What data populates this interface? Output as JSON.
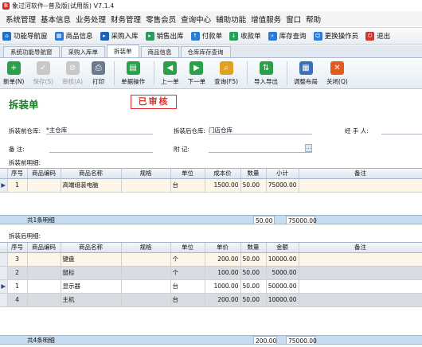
{
  "window": {
    "title": "象过河软件--普及版(试用版) V7.1.4"
  },
  "menu": [
    "系统管理",
    "基本信息",
    "业务处理",
    "财务管理",
    "零售会员",
    "查询中心",
    "辅助功能",
    "增值服务",
    "窗口",
    "帮助"
  ],
  "quickbar": [
    {
      "label": "功能导航窗",
      "icon": "home-icon",
      "color": "#1d6fd0"
    },
    {
      "label": "商品信息",
      "icon": "product-grid-icon",
      "color": "#2a7ad6"
    },
    {
      "label": "采购入库",
      "icon": "purchase-in-icon",
      "color": "#1e5fb8"
    },
    {
      "label": "销售出库",
      "icon": "sales-out-icon",
      "color": "#2a9d5a"
    },
    {
      "label": "付款单",
      "icon": "payment-icon",
      "color": "#2a7ad6"
    },
    {
      "label": "收款单",
      "icon": "receipt-icon",
      "color": "#2a9d5a"
    },
    {
      "label": "库存查询",
      "icon": "stock-query-icon",
      "color": "#2a7ad6"
    },
    {
      "label": "更换操作员",
      "icon": "switch-user-icon",
      "color": "#2a7ad6"
    },
    {
      "label": "退出",
      "icon": "exit-icon",
      "color": "#d8322b"
    }
  ],
  "tabs": [
    "系统功能导航窗",
    "采购入库单",
    "拆装单",
    "商品信息",
    "仓库库存查询"
  ],
  "active_tab": 2,
  "toolbar": [
    {
      "label": "新单(N)",
      "icon": "new-icon",
      "color": "#2aa04a",
      "glyph": "+",
      "enabled": true
    },
    {
      "label": "保存(S)",
      "icon": "save-icon",
      "color": "#888888",
      "glyph": "✓",
      "enabled": false
    },
    {
      "label": "审核(A)",
      "icon": "approve-icon",
      "color": "#888888",
      "glyph": "⊘",
      "enabled": false
    },
    {
      "label": "打印",
      "icon": "print-icon",
      "color": "#6b7a90",
      "glyph": "⎙",
      "enabled": true
    },
    {
      "label": "单据操作",
      "icon": "document-ops-icon",
      "color": "#2aa04a",
      "glyph": "▤",
      "enabled": true
    },
    {
      "label": "上一单",
      "icon": "previous-icon",
      "color": "#2aa04a",
      "glyph": "◀",
      "enabled": true
    },
    {
      "label": "下一单",
      "icon": "next-icon",
      "color": "#2aa04a",
      "glyph": "▶",
      "enabled": true
    },
    {
      "label": "查询(F5)",
      "icon": "query-icon",
      "color": "#e0a020",
      "glyph": "⌕",
      "enabled": true
    },
    {
      "label": "导入导出",
      "icon": "import-export-icon",
      "color": "#2aa04a",
      "glyph": "⇅",
      "enabled": true
    },
    {
      "label": "调整布局",
      "icon": "layout-icon",
      "color": "#3b6fb6",
      "glyph": "▦",
      "enabled": true
    },
    {
      "label": "关闭(Q)",
      "icon": "close-icon",
      "color": "#e35a1f",
      "glyph": "✕",
      "enabled": true
    }
  ],
  "form": {
    "title": "拆装单",
    "stamp": "已审核",
    "before_warehouse_label": "拆装前仓库:",
    "before_warehouse_value": "*主仓库",
    "after_warehouse_label": "拆装后仓库:",
    "after_warehouse_value": "门店仓库",
    "handler_label": "经 手 人:",
    "handler_value": "",
    "remark_label": "备    注:",
    "remark_value": "",
    "attachment_label": "附    记:",
    "attachment_value": "",
    "attachment_button": "…"
  },
  "before_grid": {
    "label": "拆装前明细:",
    "headers": [
      "序号",
      "商品编码",
      "商品名称",
      "规格",
      "单位",
      "成本价",
      "数量",
      "小计",
      "备注"
    ],
    "rows": [
      [
        "1",
        "",
        "高端组装电脑",
        "",
        "台",
        "1500.00",
        "50.00",
        "75000.00",
        ""
      ]
    ],
    "summary": {
      "count": "共1条明细",
      "qty": "50.00",
      "total": "75000.00"
    }
  },
  "after_grid": {
    "label": "拆装后明细:",
    "headers": [
      "序号",
      "商品编码",
      "商品名称",
      "规格",
      "单位",
      "单价",
      "数量",
      "金额",
      "备注"
    ],
    "rows": [
      [
        "3",
        "",
        "键盘",
        "",
        "个",
        "200.00",
        "50.00",
        "10000.00",
        ""
      ],
      [
        "2",
        "",
        "鼠标",
        "",
        "个",
        "100.00",
        "50.00",
        "5000.00",
        ""
      ],
      [
        "1",
        "",
        "显示器",
        "",
        "台",
        "1000.00",
        "50.00",
        "50000.00",
        ""
      ],
      [
        "4",
        "",
        "主机",
        "",
        "台",
        "200.00",
        "50.00",
        "10000.00",
        ""
      ]
    ],
    "summary": {
      "count": "共4条明细",
      "qty": "200.00",
      "total": "75000.00"
    }
  },
  "row_indicator": "▶"
}
